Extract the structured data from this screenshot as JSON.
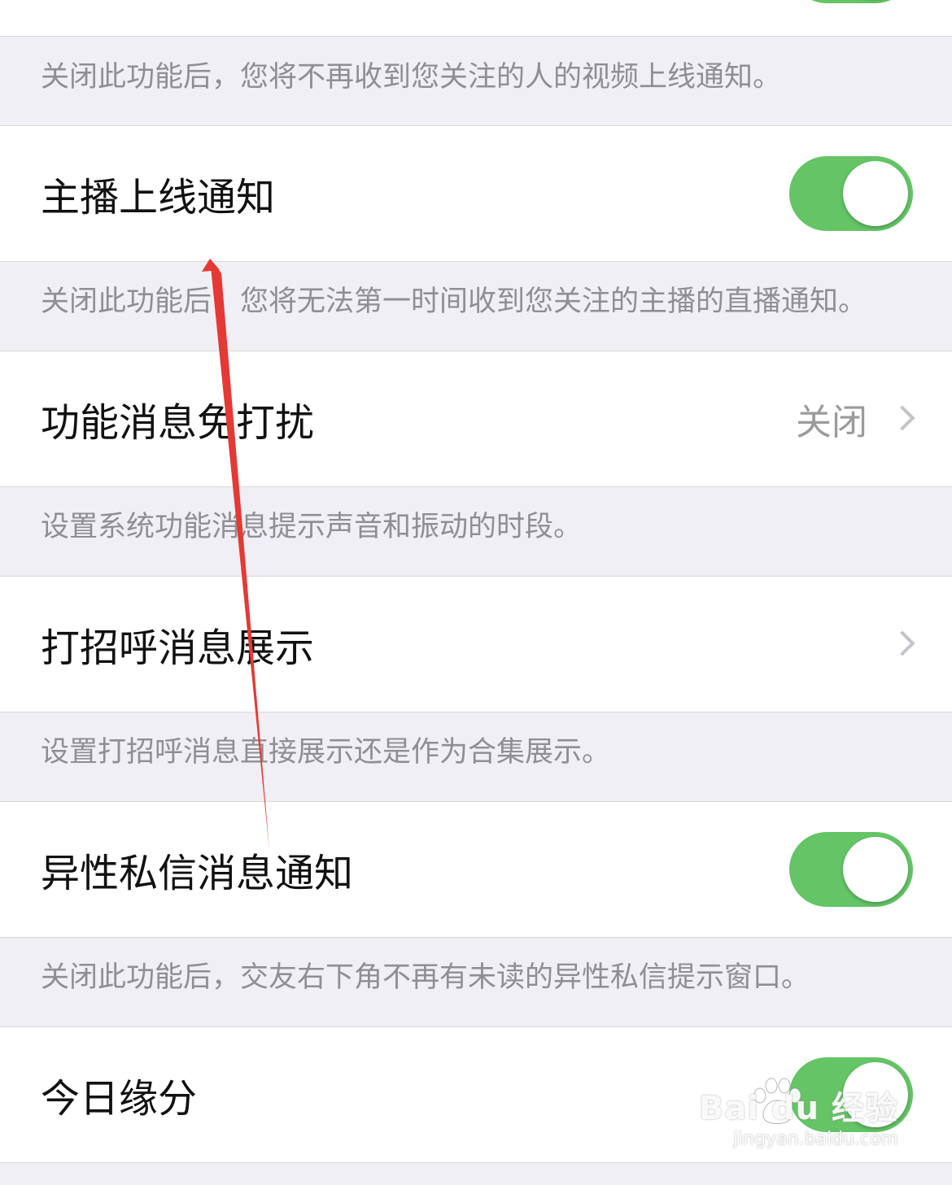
{
  "sections": [
    {
      "id": "top",
      "description": "关闭此功能后，您将不再收到您关注的人的视频上线通知。"
    },
    {
      "id": "anchor-online",
      "title": "主播上线通知",
      "control": "toggle",
      "on": true,
      "description": "关闭此功能后，您将无法第一时间收到您关注的主播的直播通知。"
    },
    {
      "id": "dnd",
      "title": "功能消息免打扰",
      "control": "chevron",
      "value": "关闭",
      "description": "设置系统功能消息提示声音和振动的时段。"
    },
    {
      "id": "greeting",
      "title": "打招呼消息展示",
      "control": "chevron",
      "description": "设置打招呼消息直接展示还是作为合集展示。"
    },
    {
      "id": "opposite-sex",
      "title": "异性私信消息通知",
      "control": "toggle",
      "on": true,
      "description": "关闭此功能后，交友右下角不再有未读的异性私信提示窗口。"
    },
    {
      "id": "today-fate",
      "title": "今日缘分",
      "control": "toggle",
      "on": true
    }
  ],
  "watermark": {
    "logo_text": "Bai du 经验",
    "url": "jingyan.baidu.com"
  },
  "colors": {
    "background": "#efeff4",
    "toggle_on": "#64c466",
    "arrow": "#e53935"
  },
  "icons": {
    "chevron": "chevron-right-icon",
    "toggle_knob": "toggle-knob",
    "paw": "baidu-paw-icon",
    "arrow": "red-arrow-annotation"
  }
}
